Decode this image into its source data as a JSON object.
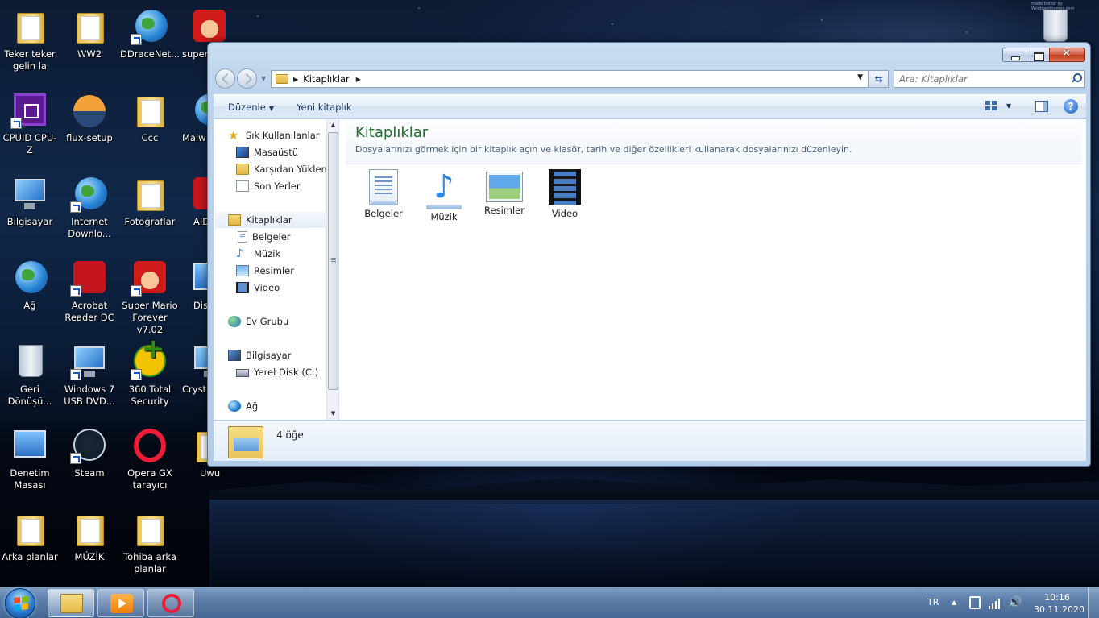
{
  "desktop": {
    "watermark": "made better by Windowsthemes.com",
    "icons": [
      {
        "label": "Teker teker gelin la",
        "icon": "user-folder-icon"
      },
      {
        "label": "WW2",
        "icon": "folder-icon"
      },
      {
        "label": "DDraceNet...",
        "icon": "globe-icon"
      },
      {
        "label": "super",
        "icon": "mario-icon"
      },
      {
        "label": "CPUID CPU-Z",
        "icon": "cpu-z-icon"
      },
      {
        "label": "flux-setup",
        "icon": "flux-icon"
      },
      {
        "label": "Ccc",
        "icon": "folder-icon"
      },
      {
        "label": "Malw",
        "icon": "malwarebytes-icon"
      },
      {
        "label": "Bilgisayar",
        "icon": "computer-icon"
      },
      {
        "label": "Internet Downlo...",
        "icon": "idm-icon"
      },
      {
        "label": "Fotoğraflar",
        "icon": "folder-icon"
      },
      {
        "label": "AID Ext",
        "icon": "aida-icon"
      },
      {
        "label": "Ağ",
        "icon": "network-icon"
      },
      {
        "label": "Acrobat Reader DC",
        "icon": "acrobat-icon"
      },
      {
        "label": "Super Mario Forever v7.02",
        "icon": "mario-icon"
      },
      {
        "label": "Dis",
        "icon": "discord-icon"
      },
      {
        "label": "Geri Dönüşü...",
        "icon": "recycle-bin-icon"
      },
      {
        "label": "Windows 7 USB DVD...",
        "icon": "usb-tool-icon"
      },
      {
        "label": "360 Total Security",
        "icon": "security-icon"
      },
      {
        "label": "Crysta",
        "icon": "crystal-icon"
      },
      {
        "label": "Denetim Masası",
        "icon": "control-panel-icon"
      },
      {
        "label": "Steam",
        "icon": "steam-icon"
      },
      {
        "label": "Opera GX tarayıcı",
        "icon": "opera-icon"
      },
      {
        "label": "Uwu",
        "icon": "folder-icon"
      },
      {
        "label": "Arka planlar",
        "icon": "folder-icon"
      },
      {
        "label": "MÜZİK",
        "icon": "folder-icon"
      },
      {
        "label": "Tohiba arka planlar",
        "icon": "folder-icon"
      }
    ]
  },
  "window": {
    "address": {
      "crumb": "Kitaplıklar"
    },
    "search": {
      "placeholder": "Ara: Kitaplıklar"
    },
    "toolbar": {
      "organize_label": "Düzenle",
      "new_library_label": "Yeni kitaplık"
    },
    "nav_pane": {
      "favorites": {
        "label": "Sık Kullanılanlar",
        "items": [
          "Masaüstü",
          "Karşıdan Yüklemeler",
          "Son Yerler"
        ]
      },
      "libraries": {
        "label": "Kitaplıklar",
        "items": [
          "Belgeler",
          "Müzik",
          "Resimler",
          "Video"
        ]
      },
      "homegroup": {
        "label": "Ev Grubu"
      },
      "computer": {
        "label": "Bilgisayar",
        "items": [
          "Yerel Disk (C:)"
        ]
      },
      "network": {
        "label": "Ağ"
      }
    },
    "main": {
      "title": "Kitaplıklar",
      "description": "Dosyalarınızı görmek için bir kitaplık açın ve klasör, tarih ve diğer özellikleri kullanarak dosyalarınızı düzenleyin.",
      "libraries": [
        {
          "label": "Belgeler",
          "icon": "documents-library-icon"
        },
        {
          "label": "Müzik",
          "icon": "music-library-icon"
        },
        {
          "label": "Resimler",
          "icon": "pictures-library-icon"
        },
        {
          "label": "Video",
          "icon": "videos-library-icon"
        }
      ]
    },
    "details": {
      "count": "4 öğe"
    }
  },
  "taskbar": {
    "apps": [
      "Windows Explorer",
      "Media Player",
      "Opera GX"
    ],
    "tray": {
      "lang": "TR",
      "time": "10:16",
      "date": "30.11.2020"
    }
  }
}
